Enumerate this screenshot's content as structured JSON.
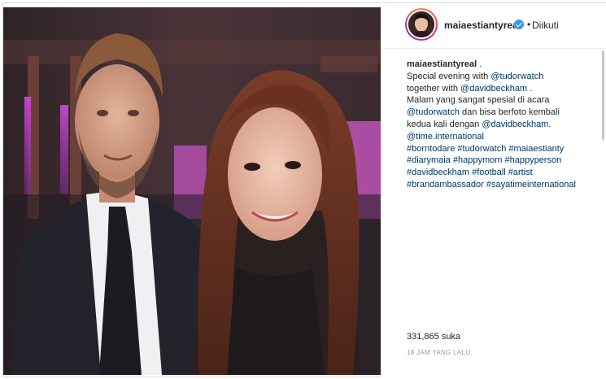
{
  "header": {
    "username": "maiaestiantyreal",
    "separator": "•",
    "follow_status": "Diikuti"
  },
  "caption": {
    "author": "maiaestiantyreal",
    "lines": [
      [
        {
          "t": "text",
          "v": "Special evening with "
        },
        {
          "t": "link",
          "v": "@tudorwatch"
        }
      ],
      [
        {
          "t": "text",
          "v": "together with "
        },
        {
          "t": "link",
          "v": "@davidbeckham"
        },
        {
          "t": "text",
          "v": " ."
        }
      ],
      [
        {
          "t": "text",
          "v": "Malam yang sangat spesial di acara"
        }
      ],
      [
        {
          "t": "link",
          "v": "@tudorwatch"
        },
        {
          "t": "text",
          "v": " dan bisa berfoto kembali"
        }
      ],
      [
        {
          "t": "text",
          "v": "kedua kali dengan "
        },
        {
          "t": "link",
          "v": "@davidbeckham"
        },
        {
          "t": "text",
          "v": "."
        }
      ],
      [
        {
          "t": "link",
          "v": "@time.international"
        }
      ],
      [
        {
          "t": "link",
          "v": "#borntodare"
        },
        {
          "t": "text",
          "v": " "
        },
        {
          "t": "link",
          "v": "#tudorwatch"
        },
        {
          "t": "text",
          "v": " "
        },
        {
          "t": "link",
          "v": "#maiaestianty"
        }
      ],
      [
        {
          "t": "link",
          "v": "#diarymaia"
        },
        {
          "t": "text",
          "v": " "
        },
        {
          "t": "link",
          "v": "#happymom"
        },
        {
          "t": "text",
          "v": " "
        },
        {
          "t": "link",
          "v": "#happyperson"
        }
      ],
      [
        {
          "t": "link",
          "v": "#davidbeckham"
        },
        {
          "t": "text",
          "v": " "
        },
        {
          "t": "link",
          "v": "#football"
        },
        {
          "t": "text",
          "v": " "
        },
        {
          "t": "link",
          "v": "#artist"
        }
      ],
      [
        {
          "t": "link",
          "v": "#brandambassador"
        },
        {
          "t": "text",
          "v": " "
        },
        {
          "t": "link",
          "v": "#sayatimeinternational"
        }
      ]
    ],
    "trailing": "."
  },
  "likes_text": "331,865 suka",
  "timestamp": "18 JAM YANG LALU",
  "colors": {
    "link": "#003569",
    "text": "#262626",
    "verified": "#3897f0",
    "muted": "#999999"
  },
  "icons": {
    "verified": "verified-badge-icon"
  }
}
